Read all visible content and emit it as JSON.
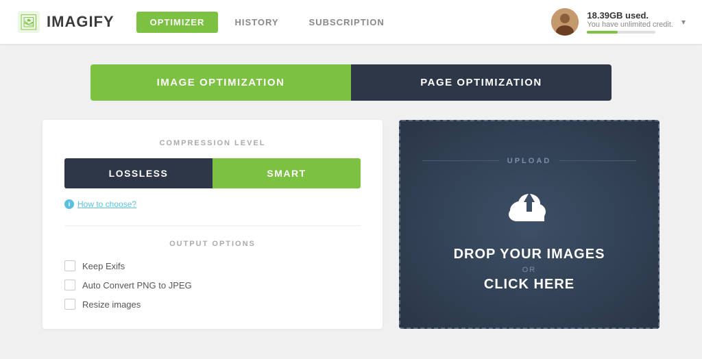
{
  "header": {
    "logo_text": "IMAGIFY",
    "nav": {
      "optimizer_label": "OPTIMIZER",
      "history_label": "HISTORY",
      "subscription_label": "SUBSCRIPTION"
    },
    "account": {
      "storage_used": "18.39GB used.",
      "credit_text": "You have unlimited credit.",
      "chevron": "▾"
    }
  },
  "tabs": {
    "image_optimization_label": "IMAGE OPTIMIZATION",
    "page_optimization_label": "PAGE OPTIMIZATION"
  },
  "left_panel": {
    "compression_label": "COMPRESSION LEVEL",
    "lossless_label": "LOSSLESS",
    "smart_label": "SMART",
    "how_to_choose_label": "How to choose?",
    "output_label": "OUTPUT OPTIONS",
    "checkboxes": [
      {
        "label": "Keep Exifs"
      },
      {
        "label": "Auto Convert PNG to JPEG"
      },
      {
        "label": "Resize images"
      }
    ]
  },
  "upload_panel": {
    "upload_label": "UPLOAD",
    "drop_text": "DROP YOUR IMAGES",
    "or_text": "OR",
    "click_text": "CLICK HERE"
  }
}
